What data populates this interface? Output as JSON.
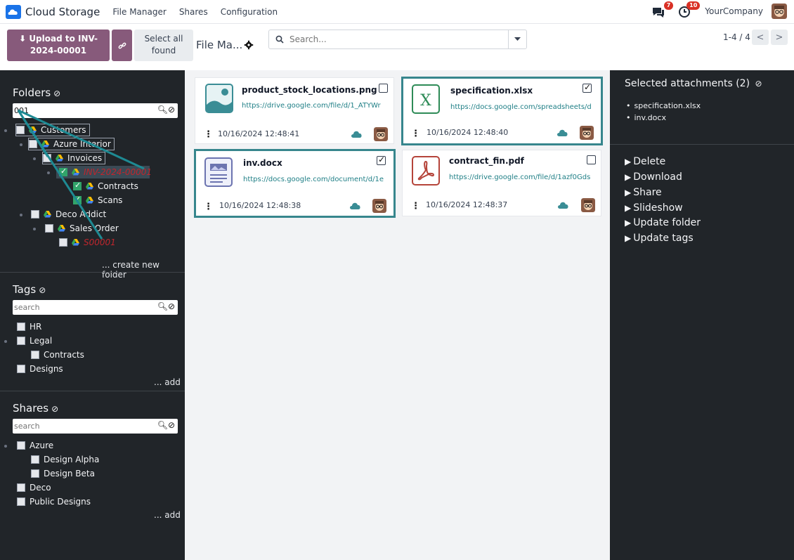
{
  "navbar": {
    "app_name": "Cloud Storage",
    "menu": [
      "File Manager",
      "Shares",
      "Configuration"
    ],
    "messages_badge": "7",
    "activities_badge": "10",
    "company": "YourCompany"
  },
  "controls": {
    "upload_label": "Upload to INV-2024-00001",
    "select_all_label": "Select all found",
    "breadcrumb": "File Ma...",
    "search_placeholder": "Search...",
    "pager": "1-4 / 4"
  },
  "folders": {
    "title": "Folders",
    "search_value": "001",
    "items": [
      {
        "label": "Customers"
      },
      {
        "label": "Azure Interior"
      },
      {
        "label": "Invoices"
      },
      {
        "label": "INV-2024-00001"
      },
      {
        "label": "Contracts"
      },
      {
        "label": "Scans"
      },
      {
        "label": "Deco Addict"
      },
      {
        "label": "Sales Order"
      },
      {
        "label": "S00001"
      }
    ],
    "create_link": "... create new folder"
  },
  "tags": {
    "title": "Tags",
    "search_placeholder": "search",
    "items": [
      {
        "label": "HR"
      },
      {
        "label": "Legal"
      },
      {
        "label": "Contracts"
      },
      {
        "label": "Designs"
      }
    ],
    "add_link": "... add"
  },
  "shares": {
    "title": "Shares",
    "search_placeholder": "search",
    "items": [
      {
        "label": "Azure"
      },
      {
        "label": "Design Alpha"
      },
      {
        "label": "Design Beta"
      },
      {
        "label": "Deco"
      },
      {
        "label": "Public Designs"
      }
    ],
    "add_link": "... add"
  },
  "files": [
    {
      "name": "product_stock_locations.png",
      "url": "https://drive.google.com/file/d/1_ATYWr",
      "date": "10/16/2024 12:48:41",
      "selected": false,
      "icon": "image-icon"
    },
    {
      "name": "specification.xlsx",
      "url": "https://docs.google.com/spreadsheets/d",
      "date": "10/16/2024 12:48:40",
      "selected": true,
      "icon": "excel-icon"
    },
    {
      "name": "inv.docx",
      "url": "https://docs.google.com/document/d/1e",
      "date": "10/16/2024 12:48:38",
      "selected": true,
      "icon": "document-icon"
    },
    {
      "name": "contract_fin.pdf",
      "url": "https://drive.google.com/file/d/1azf0Gds",
      "date": "10/16/2024 12:48:37",
      "selected": false,
      "icon": "pdf-icon"
    }
  ],
  "selection": {
    "title": "Selected attachments (2)",
    "items": [
      "specification.xlsx",
      "inv.docx"
    ],
    "actions": [
      "Delete",
      "Download",
      "Share",
      "Slideshow",
      "Update folder",
      "Update tags"
    ]
  },
  "colors": {
    "accent": "#875a7b",
    "teal": "#37868d",
    "sidebar": "#212529",
    "alert": "#d93025"
  }
}
